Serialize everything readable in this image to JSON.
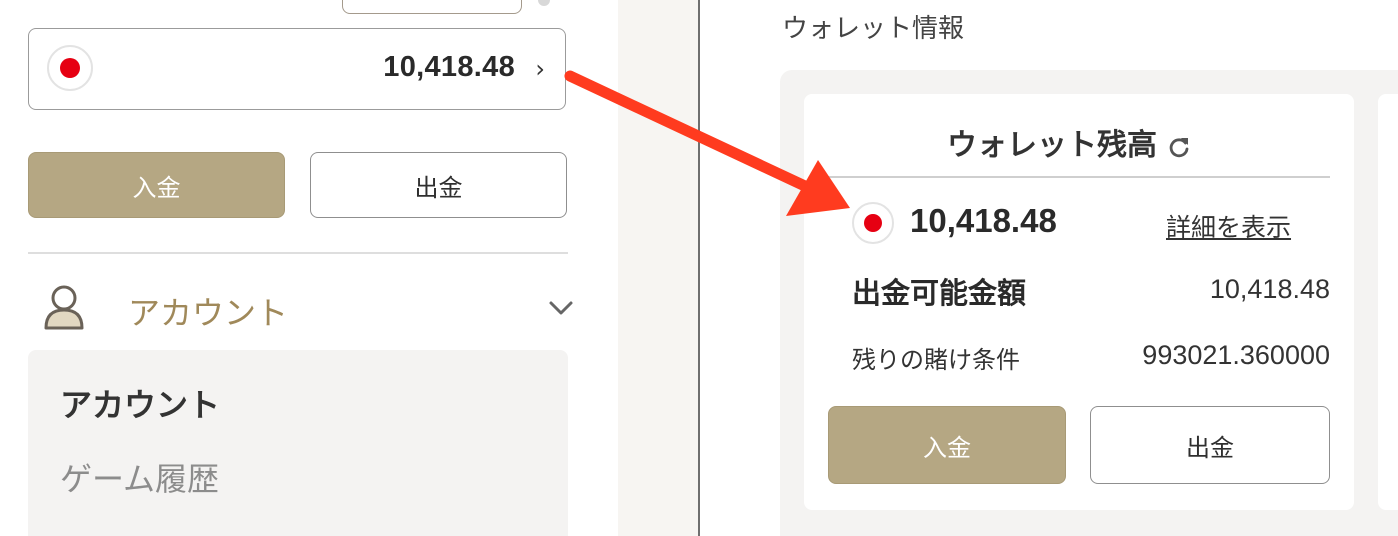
{
  "sidebar": {
    "balance_selector": {
      "amount": "10,418.48",
      "currency_flag": "japan-flag-icon",
      "chevron": "›"
    },
    "deposit_label": "入金",
    "withdraw_label": "出金",
    "account_section": {
      "label": "アカウント",
      "icon": "user-icon",
      "expanded": true
    },
    "account_submenu": {
      "title": "アカウント",
      "items": [
        {
          "label": "ゲーム履歴"
        }
      ]
    }
  },
  "wallet_info": {
    "section_title": "ウォレット情報",
    "card": {
      "title": "ウォレット残高",
      "refresh_icon": "refresh-icon",
      "balance": "10,418.48",
      "currency_flag": "japan-flag-icon",
      "details_link": "詳細を表示",
      "withdrawable_label": "出金可能金額",
      "withdrawable_value": "10,418.48",
      "wager_label": "残りの賭け条件",
      "wager_value": "993021.360000",
      "deposit_label": "入金",
      "withdraw_label": "出金"
    }
  },
  "colors": {
    "gold_button": "#b5a783",
    "account_label": "#a0895a",
    "annotation_arrow": "#ff3b1f",
    "flag_red": "#e60012"
  }
}
